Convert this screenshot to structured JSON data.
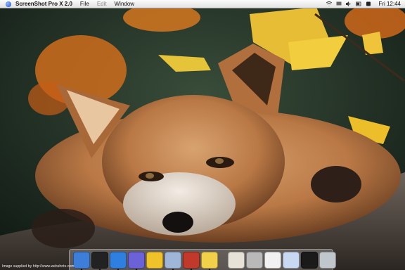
{
  "menubar": {
    "app_name": "ScreenShot Pro X 2.0",
    "menus": [
      "File",
      "Edit",
      "Window"
    ],
    "clock": "Fri 12:44"
  },
  "wallpaper": {
    "credit": "Image supplied by http://www.webshots.com"
  },
  "dock": {
    "apps": [
      {
        "name": "finder-icon",
        "color": "#3d7fd8"
      },
      {
        "name": "terminal-icon",
        "color": "#222222"
      },
      {
        "name": "internet-explorer-icon",
        "color": "#2f7fe0"
      },
      {
        "name": "ichat-icon",
        "color": "#6a62d6"
      },
      {
        "name": "font-app-icon",
        "color": "#f0c22a"
      },
      {
        "name": "itunes-icon",
        "color": "#9fb6d8"
      },
      {
        "name": "tools-icon",
        "color": "#c0392b"
      },
      {
        "name": "stickies-icon",
        "color": "#f3d04a"
      }
    ],
    "docs": [
      {
        "name": "home-folder-icon",
        "color": "#e7e2d8"
      },
      {
        "name": "hard-drive-icon",
        "color": "#b9b9b9"
      },
      {
        "name": "document-icon",
        "color": "#f1f1f1"
      },
      {
        "name": "window-thumbnail-icon",
        "color": "#c8d9f2"
      },
      {
        "name": "dark-window-icon",
        "color": "#1a1a1a"
      },
      {
        "name": "trash-icon",
        "color": "#bfc6cc"
      }
    ],
    "running": [
      "finder-icon",
      "terminal-icon",
      "internet-explorer-icon",
      "ichat-icon",
      "itunes-icon",
      "tools-icon",
      "stickies-icon"
    ]
  }
}
